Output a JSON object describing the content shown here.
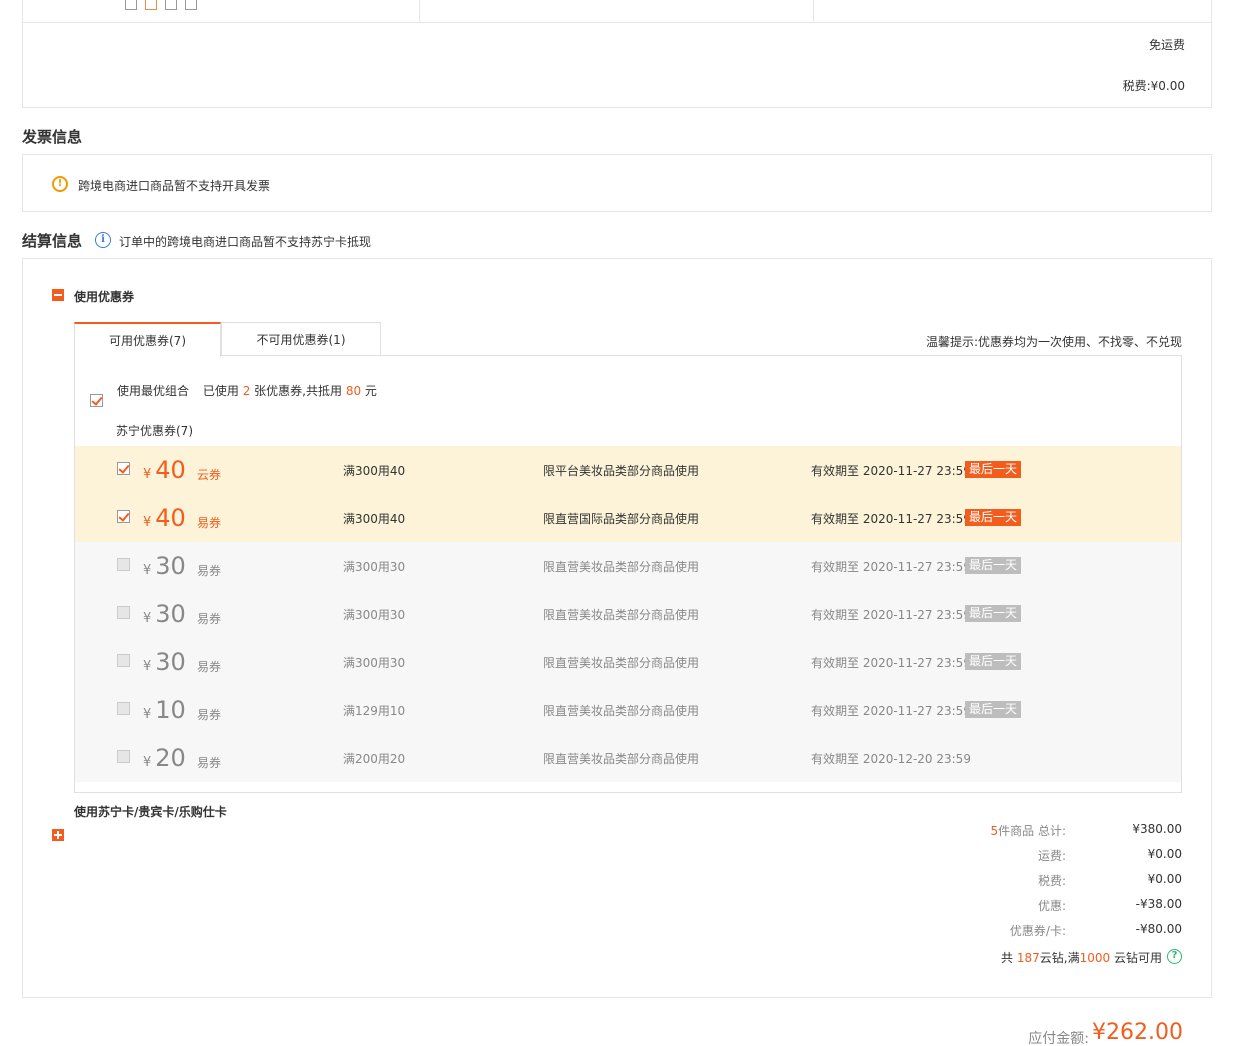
{
  "top_summary": {
    "shipping_text": "免运费",
    "tax_label": "税费:",
    "tax_value": "¥0.00"
  },
  "invoice": {
    "title": "发票信息",
    "notice": "跨境电商进口商品暂不支持开具发票"
  },
  "settlement": {
    "title": "结算信息",
    "notice": "订单中的跨境电商进口商品暂不支持苏宁卡抵现",
    "coupon_section_label": "使用优惠券",
    "tabs": [
      {
        "label": "可用优惠券(7)"
      },
      {
        "label": "不可用优惠券(1)"
      }
    ],
    "tip": "温馨提示:优惠券均为一次使用、不找零、不兑现",
    "best_combo": {
      "label": "使用最优组合",
      "used_prefix": "已使用",
      "used_count": "2",
      "used_mid": "张优惠券,共抵用",
      "used_amount": "80",
      "used_suffix": "元"
    },
    "group_title": "苏宁优惠券(7)",
    "coupons": [
      {
        "currency": "¥",
        "amount": "40",
        "type": "云券",
        "condition": "满300用40",
        "scope": "限平台美妆品类部分商品使用",
        "valid": "有效期至 2020-11-27 23:59",
        "badge": "最后一天",
        "selected": true
      },
      {
        "currency": "¥",
        "amount": "40",
        "type": "易券",
        "condition": "满300用40",
        "scope": "限直营国际品类部分商品使用",
        "valid": "有效期至 2020-11-27 23:59",
        "badge": "最后一天",
        "selected": true
      },
      {
        "currency": "¥",
        "amount": "30",
        "type": "易券",
        "condition": "满300用30",
        "scope": "限直营美妆品类部分商品使用",
        "valid": "有效期至 2020-11-27 23:59",
        "badge": "最后一天",
        "selected": false
      },
      {
        "currency": "¥",
        "amount": "30",
        "type": "易券",
        "condition": "满300用30",
        "scope": "限直营美妆品类部分商品使用",
        "valid": "有效期至 2020-11-27 23:59",
        "badge": "最后一天",
        "selected": false
      },
      {
        "currency": "¥",
        "amount": "30",
        "type": "易券",
        "condition": "满300用30",
        "scope": "限直营美妆品类部分商品使用",
        "valid": "有效期至 2020-11-27 23:59",
        "badge": "最后一天",
        "selected": false
      },
      {
        "currency": "¥",
        "amount": "10",
        "type": "易券",
        "condition": "满129用10",
        "scope": "限直营美妆品类部分商品使用",
        "valid": "有效期至 2020-11-27 23:59",
        "badge": "最后一天",
        "selected": false
      },
      {
        "currency": "¥",
        "amount": "20",
        "type": "易券",
        "condition": "满200用20",
        "scope": "限直营美妆品类部分商品使用",
        "valid": "有效期至 2020-12-20 23:59",
        "badge": "",
        "selected": false
      }
    ],
    "card_section_label": "使用苏宁卡/贵宾卡/乐购仕卡"
  },
  "summary": {
    "items_count": "5",
    "items_label": "件商品 总计:",
    "items_total": "¥380.00",
    "shipping_label": "运费:",
    "shipping_value": "¥0.00",
    "tax_label": "税费:",
    "tax_value": "¥0.00",
    "discount_label": "优惠:",
    "discount_value": "-¥38.00",
    "coupon_label": "优惠券/卡:",
    "coupon_value": "-¥80.00",
    "diamond_prefix": "共",
    "diamond_count": "187",
    "diamond_mid": "云钻,满",
    "diamond_threshold": "1000",
    "diamond_suffix": "云钻可用"
  },
  "payable": {
    "label": "应付金额:",
    "amount": "¥262.00"
  },
  "colors": {
    "accent": "#f25d1e",
    "selected_row_bg": "#fdf3d8",
    "disabled_row_bg": "#f7f7f7"
  }
}
